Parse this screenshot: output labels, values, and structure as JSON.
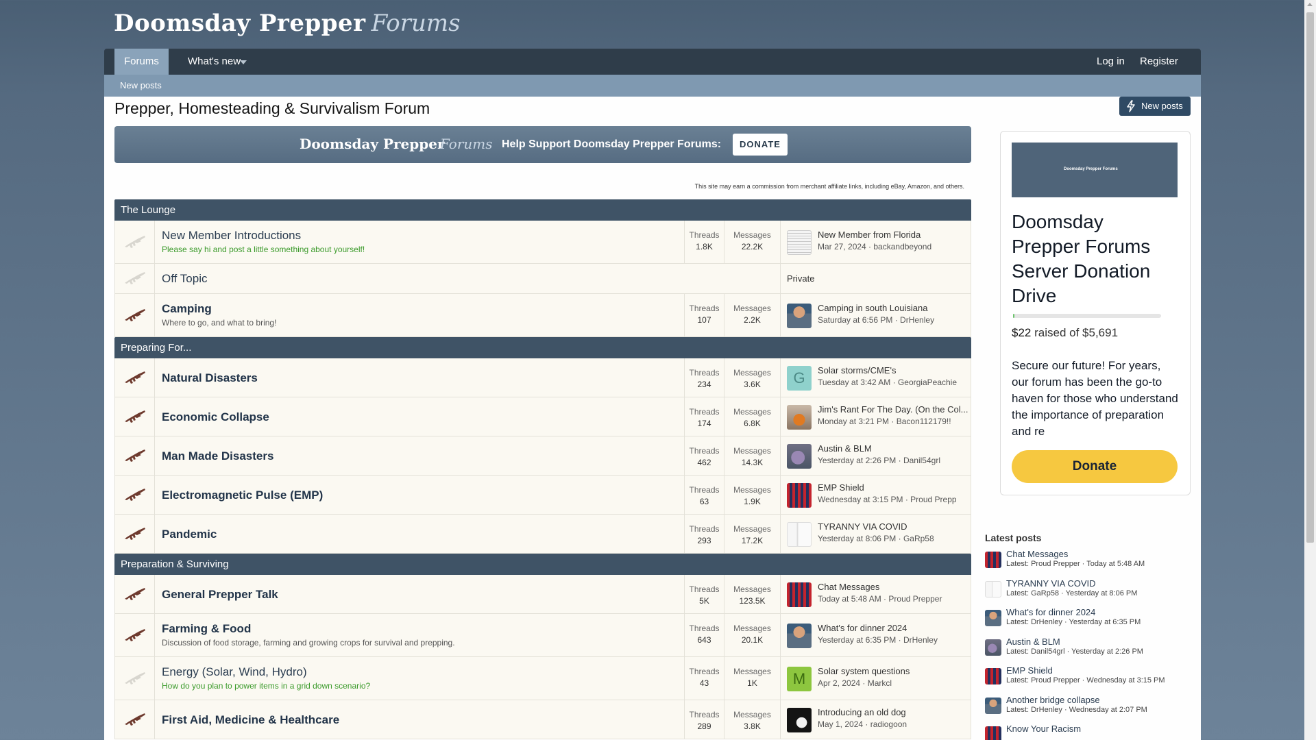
{
  "header": {
    "logo_primary": "Doomsday Prepper",
    "logo_secondary": "Forums"
  },
  "nav": {
    "tabs": [
      {
        "label": "Forums",
        "active": true
      },
      {
        "label": "What's new",
        "active": false
      }
    ],
    "login": "Log in",
    "register": "Register",
    "subnav_new_posts": "New posts"
  },
  "page": {
    "title": "Prepper, Homesteading & Survivalism Forum",
    "new_posts_button": "New posts"
  },
  "banner": {
    "logo_primary": "Doomsday Prepper",
    "logo_secondary": "Forums",
    "text": "Help Support Doomsday Prepper Forums:",
    "donate": "DONATE"
  },
  "disclaimer": "This site may earn a commission from merchant affiliate links, including eBay, Amazon, and others.",
  "categories": [
    {
      "name": "The Lounge",
      "forums": [
        {
          "title": "New Member Introductions",
          "desc": "Please say hi and post a little something about yourself!",
          "desc_green": true,
          "bold": false,
          "unread": false,
          "threads_label": "Threads",
          "threads": "1.8K",
          "messages_label": "Messages",
          "messages": "22.2K",
          "last_title": "New Member from Florida",
          "last_meta": "Mar 27, 2024 · backandbeyond",
          "avatar": "newspaper"
        },
        {
          "title": "Off Topic",
          "desc": "",
          "bold": false,
          "unread": false,
          "private": "Private"
        },
        {
          "title": "Camping",
          "desc": "Where to go, and what to bring!",
          "desc_green": false,
          "bold": true,
          "unread": true,
          "threads_label": "Threads",
          "threads": "107",
          "messages_label": "Messages",
          "messages": "2.2K",
          "last_title": "Camping in south Louisiana",
          "last_meta": "Saturday at 6:56 PM · DrHenley",
          "avatar": "man"
        }
      ]
    },
    {
      "name": "Preparing For...",
      "forums": [
        {
          "title": "Natural Disasters",
          "desc": "",
          "bold": true,
          "unread": true,
          "threads_label": "Threads",
          "threads": "234",
          "messages_label": "Messages",
          "messages": "3.6K",
          "last_title": "Solar storms/CME's",
          "last_meta": "Tuesday at 3:42 AM · GeorgiaPeachie",
          "avatar": "letter-g",
          "avatar_letter": "G"
        },
        {
          "title": "Economic Collapse",
          "desc": "",
          "bold": true,
          "unread": true,
          "threads_label": "Threads",
          "threads": "174",
          "messages_label": "Messages",
          "messages": "6.8K",
          "last_title": "Jim's Rant For The Day. (On the Col...",
          "last_meta": "Monday at 3:21 PM · Bacon112179!!",
          "avatar": "orange"
        },
        {
          "title": "Man Made Disasters",
          "desc": "",
          "bold": true,
          "unread": true,
          "threads_label": "Threads",
          "threads": "462",
          "messages_label": "Messages",
          "messages": "14.3K",
          "last_title": "Austin & BLM",
          "last_meta": "Yesterday at 2:26 PM · Danil54grl",
          "avatar": "purple"
        },
        {
          "title": "Electromagnetic Pulse (EMP)",
          "desc": "",
          "bold": true,
          "unread": true,
          "threads_label": "Threads",
          "threads": "63",
          "messages_label": "Messages",
          "messages": "1.9K",
          "last_title": "EMP Shield",
          "last_meta": "Wednesday at 3:15 PM · Proud Prepp",
          "avatar": "flag"
        },
        {
          "title": "Pandemic",
          "desc": "",
          "bold": true,
          "unread": true,
          "threads_label": "Threads",
          "threads": "293",
          "messages_label": "Messages",
          "messages": "17.2K",
          "last_title": "TYRANNY VIA COVID",
          "last_meta": "Yesterday at 8:06 PM · GaRp58",
          "avatar": "white"
        }
      ]
    },
    {
      "name": "Preparation & Surviving",
      "forums": [
        {
          "title": "General Prepper Talk",
          "desc": "",
          "bold": true,
          "unread": true,
          "threads_label": "Threads",
          "threads": "5K",
          "messages_label": "Messages",
          "messages": "123.5K",
          "last_title": "Chat Messages",
          "last_meta": "Today at 5:48 AM · Proud Prepper",
          "avatar": "flag"
        },
        {
          "title": "Farming & Food",
          "desc": "Discussion of food storage, farming and growing crops for survival and prepping.",
          "desc_green": false,
          "bold": true,
          "unread": true,
          "threads_label": "Threads",
          "threads": "643",
          "messages_label": "Messages",
          "messages": "20.1K",
          "last_title": "What's for dinner 2024",
          "last_meta": "Yesterday at 6:35 PM · DrHenley",
          "avatar": "man"
        },
        {
          "title": "Energy (Solar, Wind, Hydro)",
          "desc": "How do you plan to power items in a grid down scenario?",
          "desc_green": true,
          "bold": false,
          "unread": false,
          "threads_label": "Threads",
          "threads": "43",
          "messages_label": "Messages",
          "messages": "1K",
          "last_title": "Solar system questions",
          "last_meta": "Apr 2, 2024 · Markcl",
          "avatar": "letter-m",
          "avatar_letter": "M"
        },
        {
          "title": "First Aid, Medicine & Healthcare",
          "desc": "",
          "bold": true,
          "unread": true,
          "threads_label": "Threads",
          "threads": "289",
          "messages_label": "Messages",
          "messages": "3.8K",
          "last_title": "Introducing an old dog",
          "last_meta": "May 1, 2024 · radiogoon",
          "avatar": "dog"
        }
      ]
    }
  ],
  "sidebar": {
    "image_text": "Doomsday Prepper Forums",
    "title": "Doomsday Prepper Forums Server Donation Drive",
    "raised_amount": "$22",
    "raised_text": "raised of $5,691",
    "progress": 0.004,
    "description": "Secure our future! For years, our forum has been the go-to haven for those who understand the importance of preparation and re",
    "donate": "Donate"
  },
  "latest": {
    "title": "Latest posts",
    "items": [
      {
        "title": "Chat Messages",
        "meta": "Latest: Proud Prepper · Today at 5:48 AM",
        "avatar": "flag"
      },
      {
        "title": "TYRANNY VIA COVID",
        "meta": "Latest: GaRp58 · Yesterday at 8:06 PM",
        "avatar": "white"
      },
      {
        "title": "What's for dinner 2024",
        "meta": "Latest: DrHenley · Yesterday at 6:35 PM",
        "avatar": "man"
      },
      {
        "title": "Austin & BLM",
        "meta": "Latest: Danil54grl · Yesterday at 2:26 PM",
        "avatar": "purple"
      },
      {
        "title": "EMP Shield",
        "meta": "Latest: Proud Prepper · Wednesday at 3:15 PM",
        "avatar": "flag"
      },
      {
        "title": "Another bridge collapse",
        "meta": "Latest: DrHenley · Wednesday at 2:07 PM",
        "avatar": "man"
      },
      {
        "title": "Know Your Racism",
        "meta": "",
        "avatar": "flag"
      }
    ]
  },
  "colors": {
    "navbar": "#2f3d4a",
    "category_header": "#3f5366",
    "row_bg": "#fbf9f2",
    "donate_yellow": "#f6c840",
    "desc_green": "#3a9a2a"
  },
  "icons": {
    "forum_icon": "rifle-icon",
    "new_posts_icon": "bolt-icon"
  }
}
